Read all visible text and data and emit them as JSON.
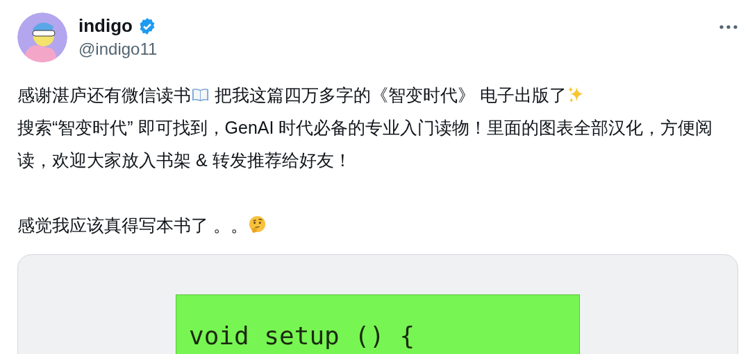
{
  "author": {
    "name": "indigo",
    "verified": true,
    "handle": "@indigo11"
  },
  "body": [
    {
      "segments": [
        {
          "kind": "text",
          "text": "感谢湛庐还有微信读书"
        },
        {
          "kind": "book"
        },
        {
          "kind": "text",
          "text": " 把我这篇四万多字的《智变时代》 电子出版了"
        },
        {
          "kind": "sparkles"
        },
        {
          "kind": "text",
          "text": "\n搜索“智变时代” 即可找到，GenAI 时代必备的专业入门读物！里面的图表全部汉化，方便阅读，欢迎大家放入书架 & 转发推荐给好友！"
        }
      ]
    },
    {
      "segments": [
        {
          "kind": "text",
          "text": "感觉我应该真得写本书了 。。"
        },
        {
          "kind": "thinking"
        }
      ]
    }
  ],
  "media": {
    "screen_text": "void setup () {"
  }
}
